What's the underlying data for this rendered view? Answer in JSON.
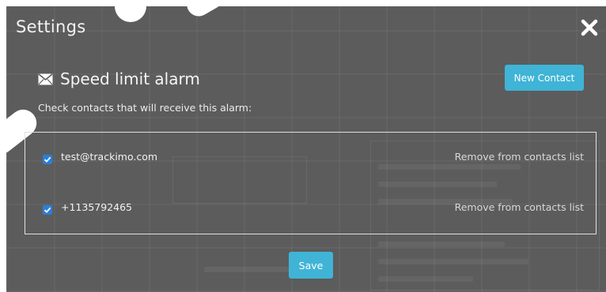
{
  "dialog": {
    "title": "Settings",
    "close_icon": "close-icon"
  },
  "alarm": {
    "icon": "mail-icon",
    "title": "Speed limit alarm",
    "new_contact_label": "New Contact",
    "instructions": "Check contacts that will receive this alarm:"
  },
  "contacts": [
    {
      "label": "test@trackimo.com",
      "checked": true,
      "remove_label": "Remove from contacts list"
    },
    {
      "label": "+1135792465",
      "checked": true,
      "remove_label": "Remove from contacts list"
    }
  ],
  "footer": {
    "save_label": "Save"
  },
  "colors": {
    "accent": "#3fb4d6",
    "checkbox": "#2a7fd8",
    "overlay": "#5c5c5c"
  }
}
